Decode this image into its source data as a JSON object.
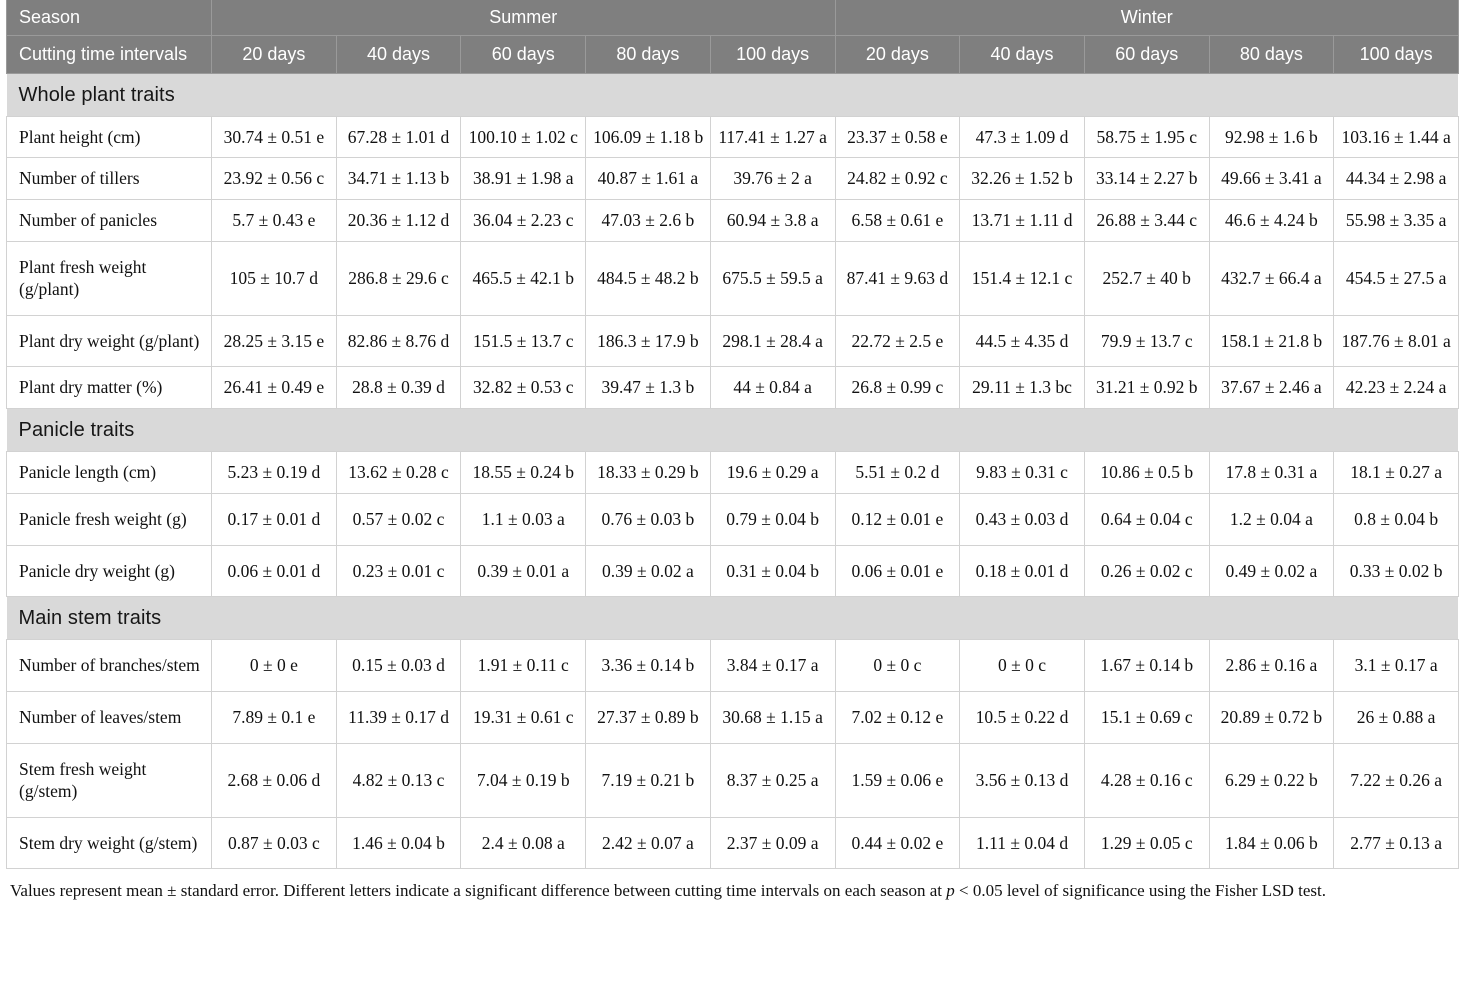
{
  "header": {
    "season_label": "Season",
    "cutting_label": "Cutting time intervals",
    "seasons": [
      {
        "name": "Summer",
        "intervals": [
          "20 days",
          "40 days",
          "60 days",
          "80 days",
          "100 days"
        ]
      },
      {
        "name": "Winter",
        "intervals": [
          "20 days",
          "40 days",
          "60 days",
          "80 days",
          "100 days"
        ]
      }
    ]
  },
  "colors": {
    "header_bg": "#7f7f7f",
    "header_text": "#ffffff",
    "section_bg": "#d9d9d9",
    "cell_border": "#d2d2d2",
    "body_text": "#111111"
  },
  "sections": [
    {
      "title": "Whole plant traits",
      "rows": [
        {
          "label": "Plant height (cm)",
          "values": [
            "30.74 ± 0.51 e",
            "67.28 ± 1.01 d",
            "100.10 ± 1.02 c",
            "106.09 ± 1.18 b",
            "117.41 ± 1.27 a",
            "23.37 ± 0.58 e",
            "47.3 ± 1.09 d",
            "58.75 ± 1.95 c",
            "92.98 ± 1.6 b",
            "103.16 ± 1.44 a"
          ]
        },
        {
          "label": "Number of tillers",
          "values": [
            "23.92 ± 0.56 c",
            "34.71 ± 1.13 b",
            "38.91 ± 1.98 a",
            "40.87 ± 1.61 a",
            "39.76 ± 2 a",
            "24.82 ± 0.92 c",
            "32.26 ± 1.52 b",
            "33.14 ± 2.27 b",
            "49.66 ± 3.41 a",
            "44.34 ± 2.98 a"
          ]
        },
        {
          "label": "Number of panicles",
          "values": [
            "5.7 ± 0.43 e",
            "20.36 ± 1.12 d",
            "36.04 ± 2.23 c",
            "47.03 ± 2.6 b",
            "60.94 ± 3.8 a",
            "6.58 ± 0.61 e",
            "13.71 ± 1.11 d",
            "26.88 ± 3.44 c",
            "46.6 ± 4.24 b",
            "55.98 ± 3.35 a"
          ]
        },
        {
          "label": "Plant fresh weight (g/plant)",
          "tall": true,
          "values": [
            "105 ± 10.7 d",
            "286.8 ± 29.6 c",
            "465.5 ± 42.1 b",
            "484.5 ± 48.2 b",
            "675.5 ± 59.5 a",
            "87.41 ± 9.63 d",
            "151.4 ± 12.1 c",
            "252.7 ± 40 b",
            "432.7 ± 66.4 a",
            "454.5 ± 27.5 a"
          ]
        },
        {
          "label": "Plant dry weight (g/plant)",
          "tall": true,
          "values": [
            "28.25 ± 3.15 e",
            "82.86 ± 8.76 d",
            "151.5 ± 13.7 c",
            "186.3 ± 17.9 b",
            "298.1 ± 28.4 a",
            "22.72 ± 2.5 e",
            "44.5 ± 4.35 d",
            "79.9 ± 13.7 c",
            "158.1 ± 21.8 b",
            "187.76 ± 8.01 a"
          ]
        },
        {
          "label": "Plant dry matter (%)",
          "values": [
            "26.41 ± 0.49 e",
            "28.8 ± 0.39 d",
            "32.82 ± 0.53 c",
            "39.47 ± 1.3 b",
            "44 ± 0.84 a",
            "26.8 ± 0.99 c",
            "29.11 ± 1.3 bc",
            "31.21 ± 0.92 b",
            "37.67 ± 2.46 a",
            "42.23 ± 2.24 a"
          ]
        }
      ]
    },
    {
      "title": "Panicle traits",
      "rows": [
        {
          "label": "Panicle length (cm)",
          "values": [
            "5.23 ± 0.19 d",
            "13.62 ± 0.28 c",
            "18.55 ± 0.24 b",
            "18.33 ± 0.29 b",
            "19.6 ± 0.29 a",
            "5.51 ± 0.2 d",
            "9.83 ± 0.31 c",
            "10.86 ± 0.5 b",
            "17.8 ± 0.31 a",
            "18.1 ± 0.27 a"
          ]
        },
        {
          "label": "Panicle fresh weight (g)",
          "tall": true,
          "values": [
            "0.17 ± 0.01 d",
            "0.57 ± 0.02 c",
            "1.1 ± 0.03 a",
            "0.76 ± 0.03 b",
            "0.79 ± 0.04 b",
            "0.12 ± 0.01 e",
            "0.43 ± 0.03 d",
            "0.64 ± 0.04 c",
            "1.2 ± 0.04 a",
            "0.8 ± 0.04 b"
          ]
        },
        {
          "label": "Panicle dry weight (g)",
          "tall": true,
          "values": [
            "0.06 ± 0.01 d",
            "0.23 ± 0.01 c",
            "0.39 ± 0.01 a",
            "0.39 ± 0.02 a",
            "0.31 ± 0.04 b",
            "0.06 ± 0.01 e",
            "0.18 ± 0.01 d",
            "0.26 ± 0.02 c",
            "0.49 ± 0.02 a",
            "0.33 ± 0.02 b"
          ]
        }
      ]
    },
    {
      "title": "Main stem traits",
      "rows": [
        {
          "label": "Number of branches/stem",
          "tall": true,
          "values": [
            "0 ± 0 e",
            "0.15 ± 0.03 d",
            "1.91 ± 0.11 c",
            "3.36 ± 0.14 b",
            "3.84 ± 0.17 a",
            "0 ± 0 c",
            "0 ± 0 c",
            "1.67 ± 0.14 b",
            "2.86 ± 0.16 a",
            "3.1 ± 0.17 a"
          ]
        },
        {
          "label": "Number of leaves/stem",
          "tall": true,
          "values": [
            "7.89 ± 0.1 e",
            "11.39 ± 0.17 d",
            "19.31 ± 0.61 c",
            "27.37 ± 0.89 b",
            "30.68 ± 1.15 a",
            "7.02 ± 0.12 e",
            "10.5 ± 0.22 d",
            "15.1 ± 0.69 c",
            "20.89 ± 0.72 b",
            "26 ± 0.88 a"
          ]
        },
        {
          "label": "Stem fresh weight (g/stem)",
          "tall": true,
          "values": [
            "2.68 ± 0.06 d",
            "4.82 ± 0.13 c",
            "7.04 ± 0.19 b",
            "7.19 ± 0.21 b",
            "8.37 ± 0.25 a",
            "1.59 ± 0.06 e",
            "3.56 ± 0.13 d",
            "4.28 ± 0.16 c",
            "6.29 ± 0.22 b",
            "7.22 ± 0.26 a"
          ]
        },
        {
          "label": "Stem dry weight (g/stem)",
          "tall": true,
          "values": [
            "0.87 ± 0.03 c",
            "1.46 ± 0.04 b",
            "2.4 ± 0.08 a",
            "2.42 ± 0.07 a",
            "2.37 ± 0.09 a",
            "0.44 ± 0.02 e",
            "1.11 ± 0.04 d",
            "1.29 ± 0.05 c",
            "1.84 ± 0.06 b",
            "2.77 ± 0.13 a"
          ]
        }
      ]
    }
  ],
  "footnote": {
    "part1": "Values represent mean ± standard error. Different letters indicate a significant difference between cutting time intervals on each season at ",
    "italic": "p",
    "part2": " < 0.05 level of significance using the Fisher LSD test."
  }
}
